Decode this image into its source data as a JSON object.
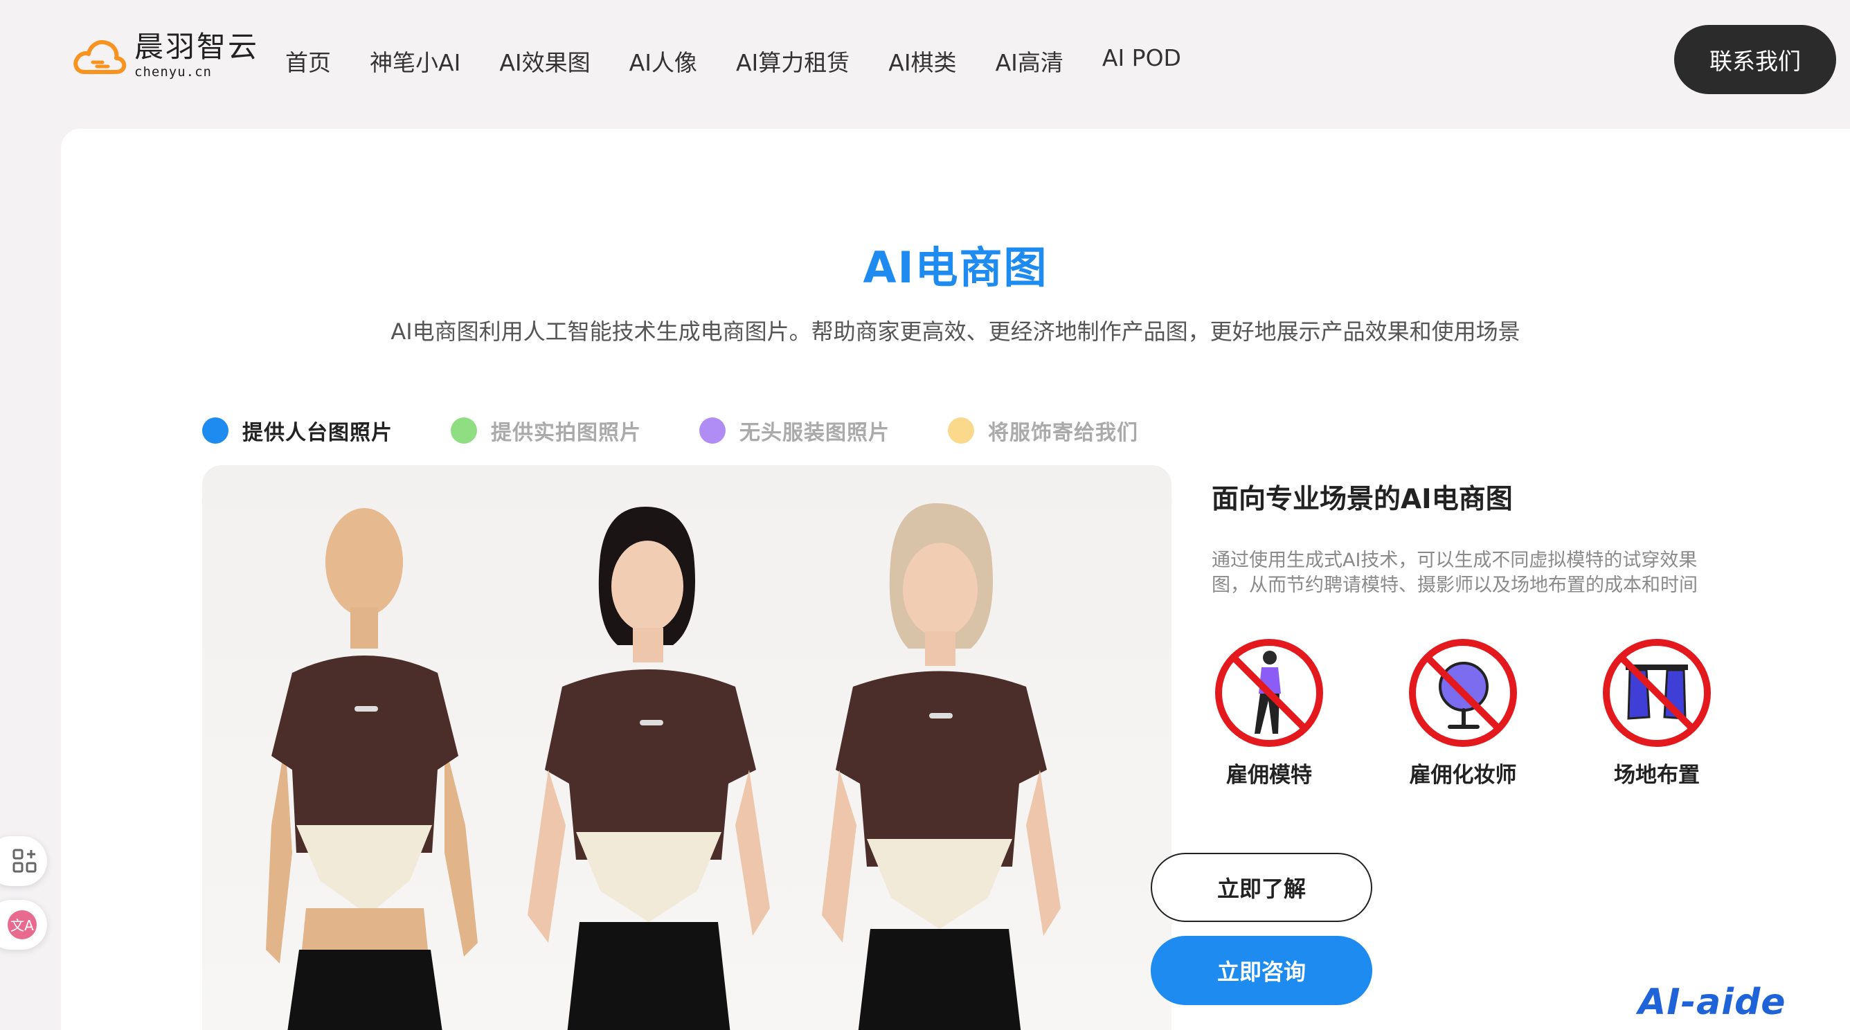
{
  "header": {
    "logo_name": "晨羽智云",
    "logo_domain": "chenyu.cn",
    "nav": [
      "首页",
      "神笔小AI",
      "AI效果图",
      "AI人像",
      "AI算力租赁",
      "AI棋类",
      "AI高清",
      "AI POD"
    ],
    "contact_label": "联系我们"
  },
  "main": {
    "title": "AI电商图",
    "subtitle": "AI电商图利用人工智能技术生成电商图片。帮助商家更高效、更经济地制作产品图，更好地展示产品效果和使用场景",
    "tabs": [
      {
        "label": "提供人台图照片",
        "color": "#1e8bf0",
        "active": true
      },
      {
        "label": "提供实拍图照片",
        "color": "#8fde82",
        "active": false
      },
      {
        "label": "无头服装图照片",
        "color": "#b08cf5",
        "active": false
      },
      {
        "label": "将服饰寄给我们",
        "color": "#fbd98c",
        "active": false
      }
    ],
    "side_title": "面向专业场景的AI电商图",
    "side_desc": "通过使用生成式AI技术，可以生成不同虚拟模特的试穿效果图，从而节约聘请模特、摄影师以及场地布置的成本和时间",
    "features": [
      {
        "label": "雇佣模特",
        "icon": "no-model-icon"
      },
      {
        "label": "雇佣化妆师",
        "icon": "no-makeup-artist-icon"
      },
      {
        "label": "场地布置",
        "icon": "no-venue-setup-icon"
      }
    ],
    "learn_label": "立即了解",
    "consult_label": "立即咨询"
  },
  "watermark": "AI-aide",
  "colors": {
    "accent": "#1e8bf0",
    "prohibition_red": "#e3191e",
    "dark_button": "#2b2b2b"
  }
}
